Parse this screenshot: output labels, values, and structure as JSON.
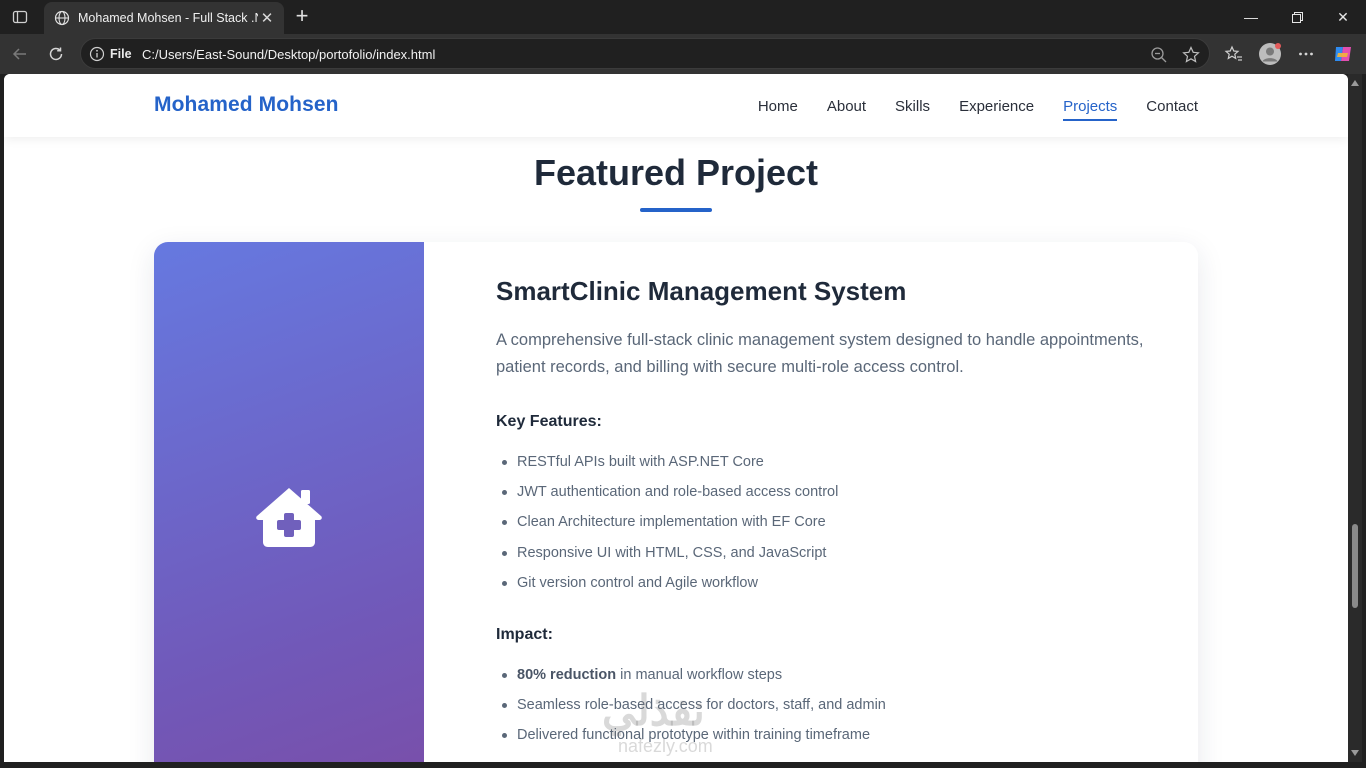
{
  "browser": {
    "tab_title": "Mohamed Mohsen - Full Stack .NET Developer",
    "address_prefix": "File",
    "url": "C:/Users/East-Sound/Desktop/portofolio/index.html"
  },
  "site": {
    "brand": "Mohamed Mohsen",
    "nav": [
      {
        "label": "Home"
      },
      {
        "label": "About"
      },
      {
        "label": "Skills"
      },
      {
        "label": "Experience"
      },
      {
        "label": "Projects"
      },
      {
        "label": "Contact"
      }
    ],
    "active_nav": "Projects"
  },
  "section": {
    "title": "Featured Project"
  },
  "project": {
    "icon": "clinic-house-plus-icon",
    "title": "SmartClinic Management System",
    "description": "A comprehensive full-stack clinic management system designed to handle appointments, patient records, and billing with secure multi-role access control.",
    "features_heading": "Key Features:",
    "features": [
      "RESTful APIs built with ASP.NET Core",
      "JWT authentication and role-based access control",
      "Clean Architecture implementation with EF Core",
      "Responsive UI with HTML, CSS, and JavaScript",
      "Git version control and Agile workflow"
    ],
    "impact_heading": "Impact:",
    "impact": [
      {
        "bold": "80% reduction",
        "rest": " in manual workflow steps"
      },
      {
        "bold": "",
        "rest": "Seamless role-based access for doctors, staff, and admin"
      },
      {
        "bold": "",
        "rest": "Delivered functional prototype within training timeframe"
      }
    ]
  },
  "watermark": {
    "text": "نفذلي",
    "sub": "nafezly.com"
  },
  "colors": {
    "accent": "#2563c9",
    "gradient_start": "#6679e0",
    "gradient_end": "#7a4ea8"
  }
}
